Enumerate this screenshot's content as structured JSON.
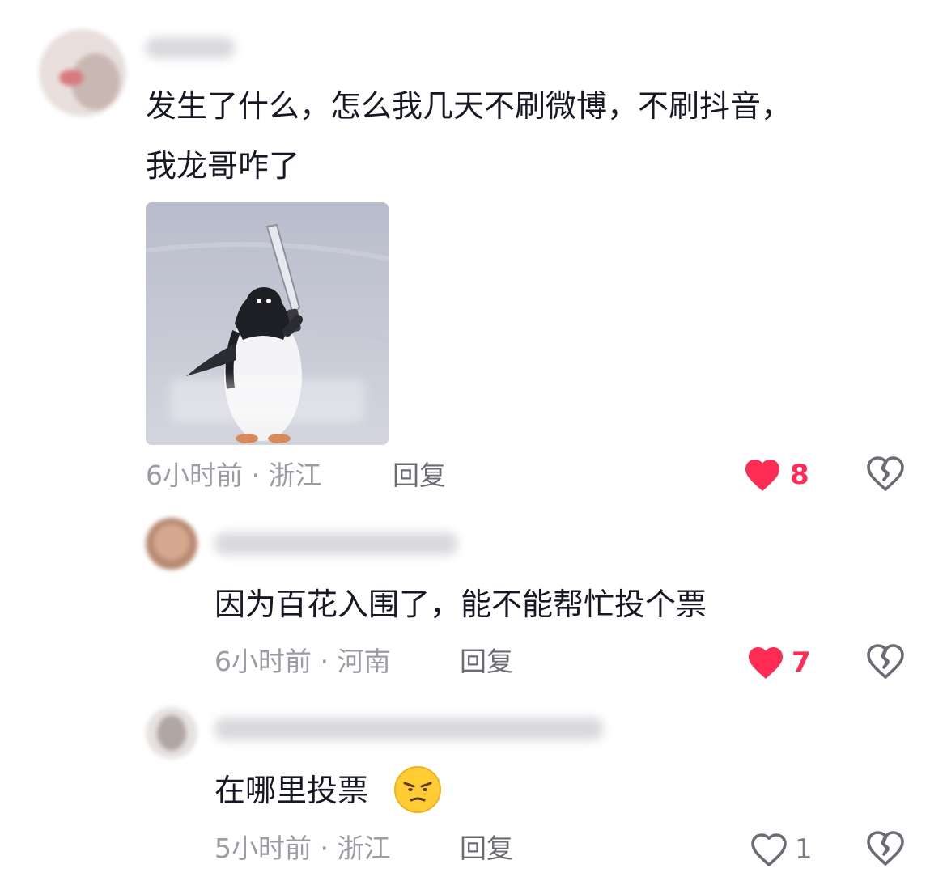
{
  "comments": [
    {
      "text_line1": "发生了什么，怎么我几天不刷微博，不刷抖音，",
      "text_line2": "我龙哥咋了",
      "meta": "6小时前 · 浙江",
      "reply_label": "回复",
      "likes": "8",
      "liked": true,
      "has_image": true,
      "image_icon": "penguin-with-knife-meme"
    },
    {
      "text": "因为百花入围了，能不能帮忙投个票",
      "meta": "6小时前 · 河南",
      "reply_label": "回复",
      "likes": "7",
      "liked": true
    },
    {
      "text": "在哪里投票",
      "emoji": "😒",
      "meta": "5小时前 · 浙江",
      "reply_label": "回复",
      "likes": "1",
      "liked": false
    }
  ],
  "colors": {
    "liked_red": "#fe2c55",
    "text_dark": "#161823",
    "meta_gray": "#9b9ca3"
  },
  "icons": [
    "heart-filled-icon",
    "heart-outline-icon",
    "broken-heart-icon",
    "smirk-emoji-icon"
  ]
}
